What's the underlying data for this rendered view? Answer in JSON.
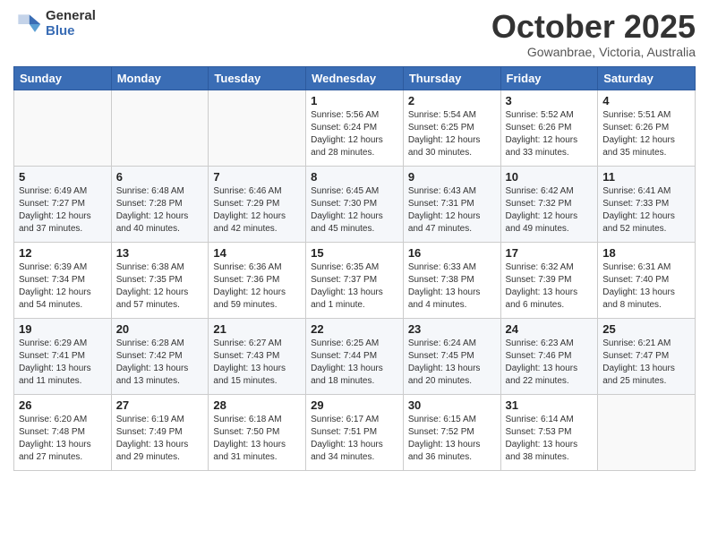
{
  "logo": {
    "general": "General",
    "blue": "Blue"
  },
  "title": "October 2025",
  "subtitle": "Gowanbrae, Victoria, Australia",
  "days_of_week": [
    "Sunday",
    "Monday",
    "Tuesday",
    "Wednesday",
    "Thursday",
    "Friday",
    "Saturday"
  ],
  "weeks": [
    [
      {
        "day": "",
        "sunrise": "",
        "sunset": "",
        "daylight": ""
      },
      {
        "day": "",
        "sunrise": "",
        "sunset": "",
        "daylight": ""
      },
      {
        "day": "",
        "sunrise": "",
        "sunset": "",
        "daylight": ""
      },
      {
        "day": "1",
        "sunrise": "Sunrise: 5:56 AM",
        "sunset": "Sunset: 6:24 PM",
        "daylight": "Daylight: 12 hours and 28 minutes."
      },
      {
        "day": "2",
        "sunrise": "Sunrise: 5:54 AM",
        "sunset": "Sunset: 6:25 PM",
        "daylight": "Daylight: 12 hours and 30 minutes."
      },
      {
        "day": "3",
        "sunrise": "Sunrise: 5:52 AM",
        "sunset": "Sunset: 6:26 PM",
        "daylight": "Daylight: 12 hours and 33 minutes."
      },
      {
        "day": "4",
        "sunrise": "Sunrise: 5:51 AM",
        "sunset": "Sunset: 6:26 PM",
        "daylight": "Daylight: 12 hours and 35 minutes."
      }
    ],
    [
      {
        "day": "5",
        "sunrise": "Sunrise: 6:49 AM",
        "sunset": "Sunset: 7:27 PM",
        "daylight": "Daylight: 12 hours and 37 minutes."
      },
      {
        "day": "6",
        "sunrise": "Sunrise: 6:48 AM",
        "sunset": "Sunset: 7:28 PM",
        "daylight": "Daylight: 12 hours and 40 minutes."
      },
      {
        "day": "7",
        "sunrise": "Sunrise: 6:46 AM",
        "sunset": "Sunset: 7:29 PM",
        "daylight": "Daylight: 12 hours and 42 minutes."
      },
      {
        "day": "8",
        "sunrise": "Sunrise: 6:45 AM",
        "sunset": "Sunset: 7:30 PM",
        "daylight": "Daylight: 12 hours and 45 minutes."
      },
      {
        "day": "9",
        "sunrise": "Sunrise: 6:43 AM",
        "sunset": "Sunset: 7:31 PM",
        "daylight": "Daylight: 12 hours and 47 minutes."
      },
      {
        "day": "10",
        "sunrise": "Sunrise: 6:42 AM",
        "sunset": "Sunset: 7:32 PM",
        "daylight": "Daylight: 12 hours and 49 minutes."
      },
      {
        "day": "11",
        "sunrise": "Sunrise: 6:41 AM",
        "sunset": "Sunset: 7:33 PM",
        "daylight": "Daylight: 12 hours and 52 minutes."
      }
    ],
    [
      {
        "day": "12",
        "sunrise": "Sunrise: 6:39 AM",
        "sunset": "Sunset: 7:34 PM",
        "daylight": "Daylight: 12 hours and 54 minutes."
      },
      {
        "day": "13",
        "sunrise": "Sunrise: 6:38 AM",
        "sunset": "Sunset: 7:35 PM",
        "daylight": "Daylight: 12 hours and 57 minutes."
      },
      {
        "day": "14",
        "sunrise": "Sunrise: 6:36 AM",
        "sunset": "Sunset: 7:36 PM",
        "daylight": "Daylight: 12 hours and 59 minutes."
      },
      {
        "day": "15",
        "sunrise": "Sunrise: 6:35 AM",
        "sunset": "Sunset: 7:37 PM",
        "daylight": "Daylight: 13 hours and 1 minute."
      },
      {
        "day": "16",
        "sunrise": "Sunrise: 6:33 AM",
        "sunset": "Sunset: 7:38 PM",
        "daylight": "Daylight: 13 hours and 4 minutes."
      },
      {
        "day": "17",
        "sunrise": "Sunrise: 6:32 AM",
        "sunset": "Sunset: 7:39 PM",
        "daylight": "Daylight: 13 hours and 6 minutes."
      },
      {
        "day": "18",
        "sunrise": "Sunrise: 6:31 AM",
        "sunset": "Sunset: 7:40 PM",
        "daylight": "Daylight: 13 hours and 8 minutes."
      }
    ],
    [
      {
        "day": "19",
        "sunrise": "Sunrise: 6:29 AM",
        "sunset": "Sunset: 7:41 PM",
        "daylight": "Daylight: 13 hours and 11 minutes."
      },
      {
        "day": "20",
        "sunrise": "Sunrise: 6:28 AM",
        "sunset": "Sunset: 7:42 PM",
        "daylight": "Daylight: 13 hours and 13 minutes."
      },
      {
        "day": "21",
        "sunrise": "Sunrise: 6:27 AM",
        "sunset": "Sunset: 7:43 PM",
        "daylight": "Daylight: 13 hours and 15 minutes."
      },
      {
        "day": "22",
        "sunrise": "Sunrise: 6:25 AM",
        "sunset": "Sunset: 7:44 PM",
        "daylight": "Daylight: 13 hours and 18 minutes."
      },
      {
        "day": "23",
        "sunrise": "Sunrise: 6:24 AM",
        "sunset": "Sunset: 7:45 PM",
        "daylight": "Daylight: 13 hours and 20 minutes."
      },
      {
        "day": "24",
        "sunrise": "Sunrise: 6:23 AM",
        "sunset": "Sunset: 7:46 PM",
        "daylight": "Daylight: 13 hours and 22 minutes."
      },
      {
        "day": "25",
        "sunrise": "Sunrise: 6:21 AM",
        "sunset": "Sunset: 7:47 PM",
        "daylight": "Daylight: 13 hours and 25 minutes."
      }
    ],
    [
      {
        "day": "26",
        "sunrise": "Sunrise: 6:20 AM",
        "sunset": "Sunset: 7:48 PM",
        "daylight": "Daylight: 13 hours and 27 minutes."
      },
      {
        "day": "27",
        "sunrise": "Sunrise: 6:19 AM",
        "sunset": "Sunset: 7:49 PM",
        "daylight": "Daylight: 13 hours and 29 minutes."
      },
      {
        "day": "28",
        "sunrise": "Sunrise: 6:18 AM",
        "sunset": "Sunset: 7:50 PM",
        "daylight": "Daylight: 13 hours and 31 minutes."
      },
      {
        "day": "29",
        "sunrise": "Sunrise: 6:17 AM",
        "sunset": "Sunset: 7:51 PM",
        "daylight": "Daylight: 13 hours and 34 minutes."
      },
      {
        "day": "30",
        "sunrise": "Sunrise: 6:15 AM",
        "sunset": "Sunset: 7:52 PM",
        "daylight": "Daylight: 13 hours and 36 minutes."
      },
      {
        "day": "31",
        "sunrise": "Sunrise: 6:14 AM",
        "sunset": "Sunset: 7:53 PM",
        "daylight": "Daylight: 13 hours and 38 minutes."
      },
      {
        "day": "",
        "sunrise": "",
        "sunset": "",
        "daylight": ""
      }
    ]
  ]
}
